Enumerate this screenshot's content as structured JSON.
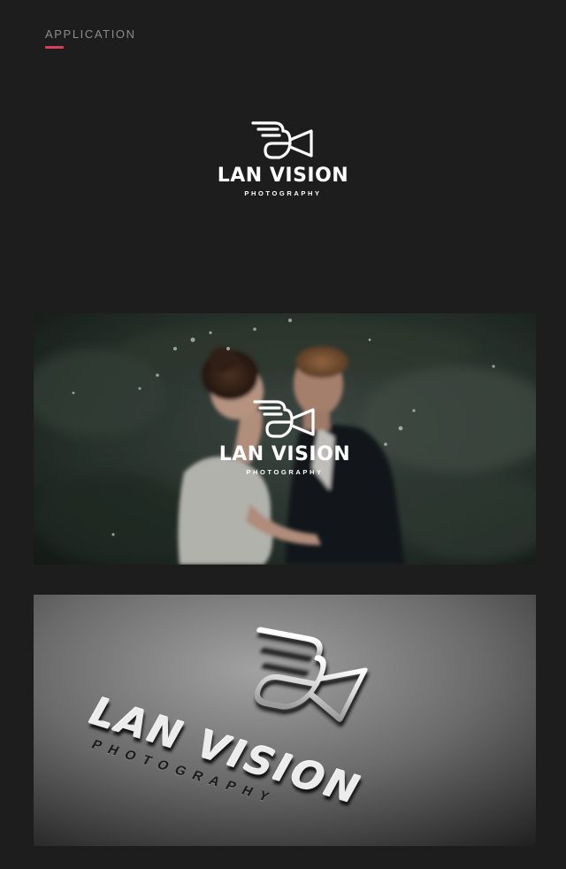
{
  "section": {
    "label": "APPLICATION",
    "accent_color": "#d64059"
  },
  "logo": {
    "mark_icon": "winged-camera-icon",
    "name": "LAN VISION",
    "tagline": "PHOTOGRAPHY"
  },
  "photo_mockup": {
    "image": "wedding-couple-photo",
    "overlay_icon": "winged-camera-icon"
  },
  "emboss_mockup": {
    "image": "silver-embossed-logo-on-textured-paper",
    "mark_icon": "winged-camera-icon"
  },
  "colors": {
    "background": "#1d1d1e",
    "logo": "#ffffff"
  }
}
